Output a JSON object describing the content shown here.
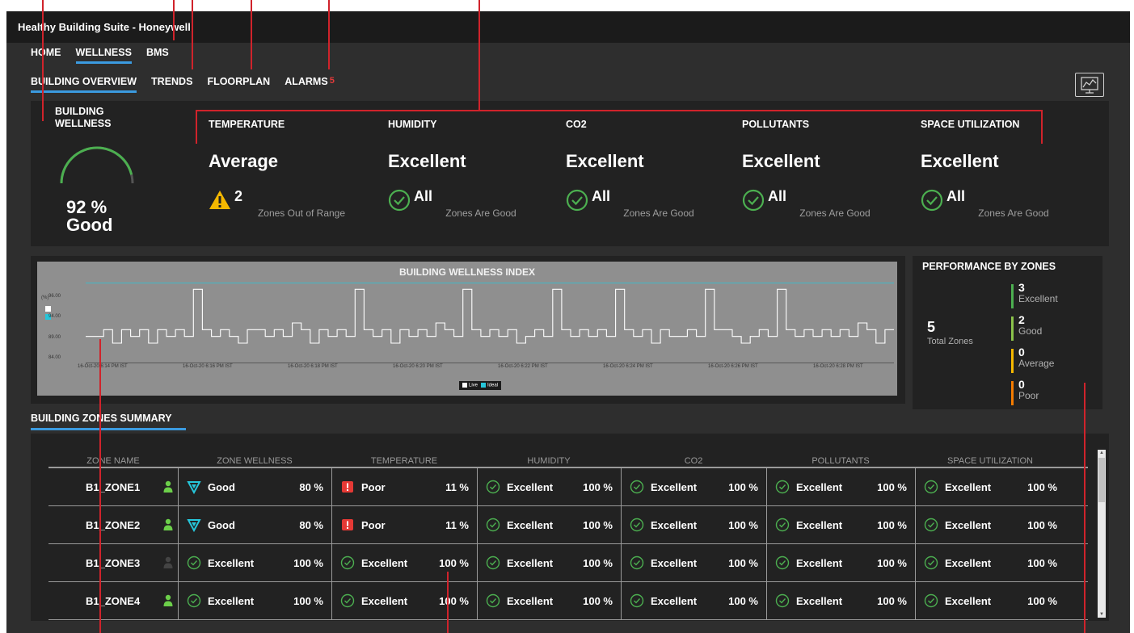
{
  "app": {
    "title": "Healthy Building Suite - Honeywell"
  },
  "nav_primary": [
    "HOME",
    "WELLNESS",
    "BMS"
  ],
  "nav_secondary": [
    "BUILDING OVERVIEW",
    "TRENDS",
    "FLOORPLAN",
    "ALARMS"
  ],
  "alarm_count": "5",
  "building_wellness": {
    "label": "BUILDING WELLNESS",
    "percent": "92 %",
    "status": "Good",
    "gauge_fraction": 0.92
  },
  "kpis": [
    {
      "category": "TEMPERATURE",
      "rating": "Average",
      "count": "2",
      "subtext": "Zones Out of Range",
      "icon": "warning-icon"
    },
    {
      "category": "HUMIDITY",
      "rating": "Excellent",
      "count": "All",
      "subtext": "Zones Are Good",
      "icon": "check-circle-icon"
    },
    {
      "category": "CO2",
      "rating": "Excellent",
      "count": "All",
      "subtext": "Zones Are Good",
      "icon": "check-circle-icon"
    },
    {
      "category": "POLLUTANTS",
      "rating": "Excellent",
      "count": "All",
      "subtext": "Zones Are Good",
      "icon": "check-circle-icon"
    },
    {
      "category": "SPACE UTILIZATION",
      "rating": "Excellent",
      "count": "All",
      "subtext": "Zones Are Good",
      "icon": "check-circle-icon"
    }
  ],
  "chart": {
    "title": "BUILDING WELLNESS INDEX",
    "ylabel": "(%)",
    "yticks": [
      "96.00",
      "94.00",
      "89.00",
      "84.00"
    ],
    "xticks": [
      "16-Oct-20 6:14 PM IST",
      "16-Oct-20 6:16 PM IST",
      "16-Oct-20 6:18 PM IST",
      "16-Oct-20 6:20 PM IST",
      "16-Oct-20 6:22 PM IST",
      "16-Oct-20 6:24 PM IST",
      "16-Oct-20 6:26 PM IST",
      "16-Oct-20 6:28 PM IST"
    ],
    "legend": [
      "Live",
      "Ideal"
    ]
  },
  "chart_data": {
    "type": "line",
    "title": "BUILDING WELLNESS INDEX",
    "ylabel": "(%)",
    "ylim": [
      84,
      96
    ],
    "series": [
      {
        "name": "Live",
        "values": [
          88,
          88,
          89,
          87,
          89,
          88,
          89,
          87,
          89,
          88,
          89,
          88,
          95,
          89,
          88,
          89,
          88,
          87,
          89,
          89,
          88,
          89,
          88,
          90,
          89,
          87,
          89,
          88,
          89,
          88,
          95,
          89,
          88,
          89,
          87,
          89,
          88,
          89,
          88,
          90,
          89,
          88,
          95,
          89,
          88,
          89,
          88,
          89,
          87,
          88,
          89,
          88,
          95,
          89,
          88,
          89,
          88,
          89,
          88,
          95,
          89,
          88,
          89,
          87,
          89,
          88,
          88,
          89,
          88,
          95,
          89,
          89,
          88,
          87,
          88,
          89,
          88,
          95,
          89,
          88,
          89,
          88,
          89,
          88,
          89,
          88,
          90,
          89,
          87,
          89
        ]
      },
      {
        "name": "Ideal",
        "values": [
          96,
          96,
          96,
          96,
          96,
          96,
          96,
          96,
          96,
          96,
          96,
          96,
          96,
          96,
          96,
          96,
          96,
          96,
          96,
          96,
          96,
          96,
          96,
          96,
          96,
          96,
          96,
          96,
          96,
          96,
          96,
          96,
          96,
          96,
          96,
          96,
          96,
          96,
          96,
          96,
          96,
          96,
          96,
          96,
          96,
          96,
          96,
          96,
          96,
          96,
          96,
          96,
          96,
          96,
          96,
          96,
          96,
          96,
          96,
          96,
          96,
          96,
          96,
          96,
          96,
          96,
          96,
          96,
          96,
          96,
          96,
          96,
          96,
          96,
          96,
          96,
          96,
          96,
          96,
          96,
          96,
          96,
          96,
          96,
          96,
          96,
          96,
          96,
          96,
          96
        ]
      }
    ],
    "colors": {
      "live": "#ffffff",
      "ideal": "#26c6da"
    }
  },
  "performance": {
    "title": "PERFORMANCE BY ZONES",
    "total": "5",
    "total_label": "Total Zones",
    "items": [
      {
        "count": "3",
        "label": "Excellent",
        "color": "#4caf50"
      },
      {
        "count": "2",
        "label": "Good",
        "color": "#8bc34a"
      },
      {
        "count": "0",
        "label": "Average",
        "color": "#f5b800"
      },
      {
        "count": "0",
        "label": "Poor",
        "color": "#f57c00"
      }
    ]
  },
  "zones_summary": {
    "tab": "BUILDING ZONES SUMMARY",
    "columns": [
      "ZONE NAME",
      "ZONE WELLNESS",
      "TEMPERATURE",
      "HUMIDITY",
      "CO2",
      "POLLUTANTS",
      "SPACE UTILIZATION"
    ],
    "rows": [
      {
        "zone": "B1_ZONE1",
        "occupied": true,
        "cells": [
          {
            "status": "Good",
            "value": "80 %",
            "icon": "shield-icon"
          },
          {
            "status": "Poor",
            "value": "11 %",
            "icon": "alert-icon"
          },
          {
            "status": "Excellent",
            "value": "100 %",
            "icon": "check-circle-icon"
          },
          {
            "status": "Excellent",
            "value": "100 %",
            "icon": "check-circle-icon"
          },
          {
            "status": "Excellent",
            "value": "100 %",
            "icon": "check-circle-icon"
          },
          {
            "status": "Excellent",
            "value": "100 %",
            "icon": "check-circle-icon"
          }
        ]
      },
      {
        "zone": "B1_ZONE2",
        "occupied": true,
        "cells": [
          {
            "status": "Good",
            "value": "80 %",
            "icon": "shield-icon"
          },
          {
            "status": "Poor",
            "value": "11 %",
            "icon": "alert-icon"
          },
          {
            "status": "Excellent",
            "value": "100 %",
            "icon": "check-circle-icon"
          },
          {
            "status": "Excellent",
            "value": "100 %",
            "icon": "check-circle-icon"
          },
          {
            "status": "Excellent",
            "value": "100 %",
            "icon": "check-circle-icon"
          },
          {
            "status": "Excellent",
            "value": "100 %",
            "icon": "check-circle-icon"
          }
        ]
      },
      {
        "zone": "B1_ZONE3",
        "occupied": false,
        "cells": [
          {
            "status": "Excellent",
            "value": "100 %",
            "icon": "check-circle-icon"
          },
          {
            "status": "Excellent",
            "value": "100 %",
            "icon": "check-circle-icon"
          },
          {
            "status": "Excellent",
            "value": "100 %",
            "icon": "check-circle-icon"
          },
          {
            "status": "Excellent",
            "value": "100 %",
            "icon": "check-circle-icon"
          },
          {
            "status": "Excellent",
            "value": "100 %",
            "icon": "check-circle-icon"
          },
          {
            "status": "Excellent",
            "value": "100 %",
            "icon": "check-circle-icon"
          }
        ]
      },
      {
        "zone": "B1_ZONE4",
        "occupied": true,
        "cells": [
          {
            "status": "Excellent",
            "value": "100 %",
            "icon": "check-circle-icon"
          },
          {
            "status": "Excellent",
            "value": "100 %",
            "icon": "check-circle-icon"
          },
          {
            "status": "Excellent",
            "value": "100 %",
            "icon": "check-circle-icon"
          },
          {
            "status": "Excellent",
            "value": "100 %",
            "icon": "check-circle-icon"
          },
          {
            "status": "Excellent",
            "value": "100 %",
            "icon": "check-circle-icon"
          },
          {
            "status": "Excellent",
            "value": "100 %",
            "icon": "check-circle-icon"
          }
        ]
      }
    ]
  },
  "colors": {
    "accent": "#3b9be0",
    "ok": "#4caf50",
    "warn": "#f5b800",
    "poor": "#e53935",
    "good": "#26c6da",
    "callout": "#d0232b"
  }
}
